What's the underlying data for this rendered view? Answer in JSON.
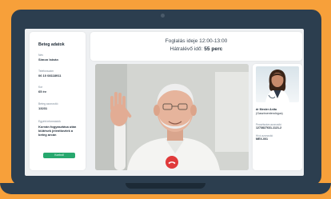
{
  "colors": {
    "background": "#f7a03a",
    "laptop_frame": "#2c3e4f",
    "accent_green": "#27a86e",
    "hangup_red": "#e03a3a"
  },
  "patient_panel": {
    "title": "Beteg adatok",
    "fields": [
      {
        "label": "Név",
        "value": "Simon István"
      },
      {
        "label": "Telefonszám",
        "value": "06 10 08118911"
      },
      {
        "label": "Kor",
        "value": "65 év"
      },
      {
        "label": "Beteg azonosító",
        "value": "13231"
      }
    ],
    "note_label": "Egyéb információk",
    "note": "Korván fogyasztása után kiütések jelentkeztek a beteg arcán",
    "button_label": "Kontroll"
  },
  "call_header": {
    "appointment_label": "Foglalás ideje",
    "appointment_time": "12:00-13:00",
    "remaining_label": "Hátralévő idő:",
    "remaining_value": "55 perc"
  },
  "video": {
    "hangup_icon": "phone-hangup-icon"
  },
  "doctor_panel": {
    "name": "dr Mester Anita",
    "specialty": "(Gasztroenterológus)",
    "fields": [
      {
        "label": "Pecsétszám azonosító",
        "value": "1273827631-1121-2"
      },
      {
        "label": "Hívó azonosító",
        "value": "MEX-001"
      }
    ]
  }
}
